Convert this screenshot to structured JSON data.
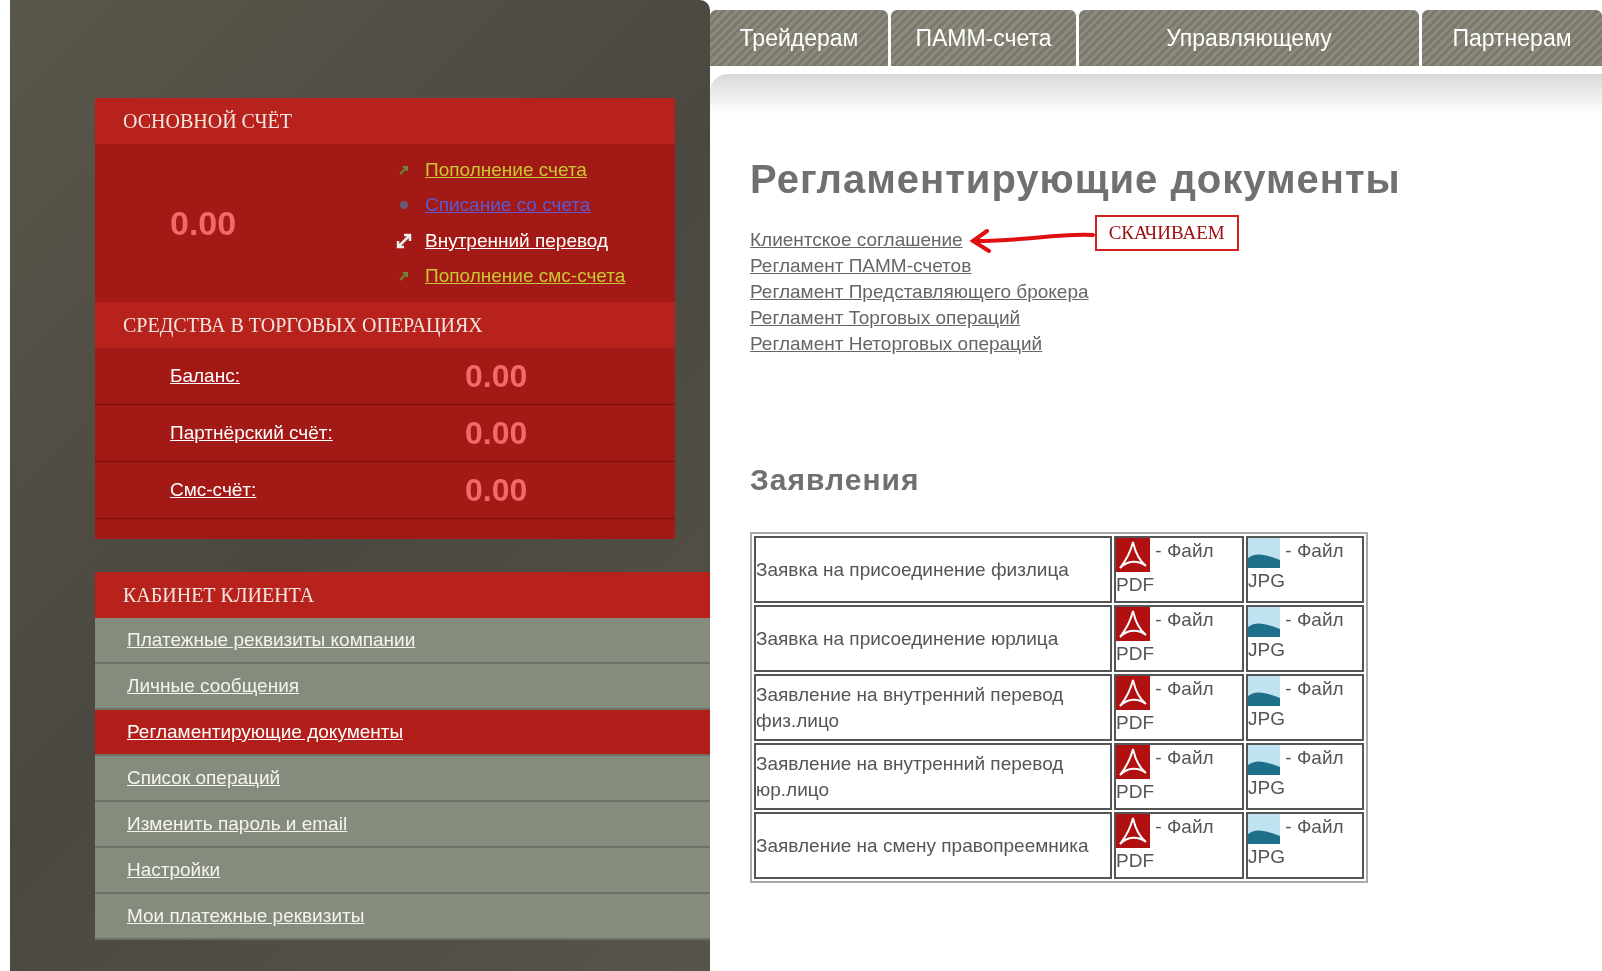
{
  "main_account": {
    "title": "ОСНОВНОЙ СЧЁТ",
    "balance": "0.00",
    "links": [
      {
        "kind": "deposit",
        "label": "Пополнение счета",
        "color": "#c8c832"
      },
      {
        "kind": "withdraw",
        "label": "Списание со счета",
        "color": "#5a5ad2"
      },
      {
        "kind": "transfer",
        "label": "Внутренний перевод",
        "color": "#ffffff"
      },
      {
        "kind": "deposit",
        "label": "Пополнение смс-счета",
        "color": "#c8c832"
      }
    ]
  },
  "trading_funds": {
    "title": "СРЕДСТВА В ТОРГОВЫХ ОПЕРАЦИЯХ",
    "rows": [
      {
        "label": "Баланс:",
        "value": "0.00"
      },
      {
        "label": "Партнёрский счёт:",
        "value": "0.00"
      },
      {
        "label": "Смс-счёт:",
        "value": "0.00"
      }
    ]
  },
  "cabinet": {
    "title": "КАБИНЕТ КЛИЕНТА",
    "items": [
      {
        "label": "Платежные реквизиты компании",
        "selected": false
      },
      {
        "label": "Личные сообщения",
        "selected": false
      },
      {
        "label": "Регламентирующие документы",
        "selected": true
      },
      {
        "label": "Список операций",
        "selected": false
      },
      {
        "label": "Изменить пароль и email",
        "selected": false
      },
      {
        "label": "Настройки",
        "selected": false
      },
      {
        "label": "Мои платежные реквизиты",
        "selected": false
      }
    ]
  },
  "tabs": [
    "Трейдерам",
    "ПАММ-счета",
    "Управляющему",
    "Партнерам"
  ],
  "page": {
    "title": "Регламентирующие документы",
    "documents": [
      "Клиентское соглашение",
      "Регламент ПАММ-счетов",
      "Регламент Представляющего брокера",
      "Регламент Торговых операций",
      "Регламент Неторговых операций"
    ],
    "annotation": "СКАЧИВАЕМ",
    "applications_title": "Заявления",
    "applications": [
      {
        "name": "Заявка на присоединение физлица",
        "pdf": "- Файл PDF",
        "jpg": "- Файл JPG"
      },
      {
        "name": "Заявка на присоединение юрлица",
        "pdf": "- Файл PDF",
        "jpg": "- Файл JPG"
      },
      {
        "name": "Заявление на внутренний перевод физ.лицо",
        "pdf": "- Файл PDF",
        "jpg": "- Файл JPG"
      },
      {
        "name": "Заявление на внутренний перевод юр.лицо",
        "pdf": "- Файл PDF",
        "jpg": "- Файл JPG"
      },
      {
        "name": "Заявление на смену правопреемника",
        "pdf": "- Файл PDF",
        "jpg": "- Файл JPG"
      }
    ]
  }
}
